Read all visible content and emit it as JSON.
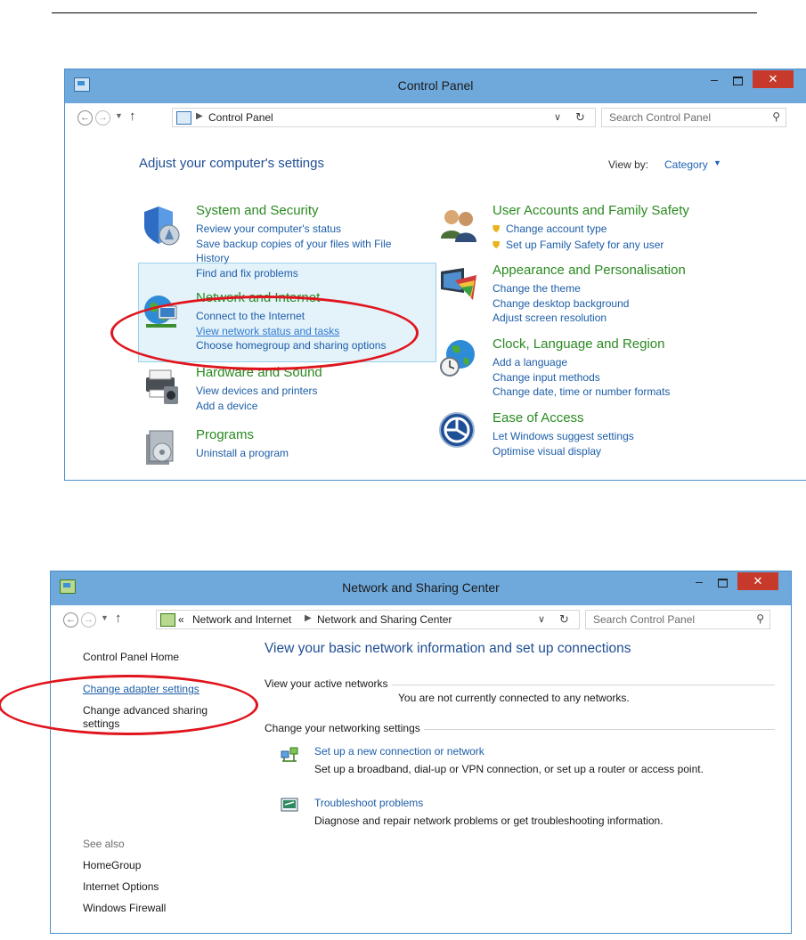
{
  "control_panel": {
    "title": "Control Panel",
    "address_crumb": "Control Panel",
    "search_placeholder": "Search Control Panel",
    "heading": "Adjust your computer's settings",
    "view_by_label": "View by:",
    "view_by_value": "Category",
    "categories": [
      {
        "title": "System and Security",
        "icon": "shield-icon",
        "links": [
          "Review your computer's status",
          "Save backup copies of your files with File",
          "History",
          "Find and fix problems"
        ]
      },
      {
        "title": "Network and Internet",
        "icon": "globe-network-icon",
        "links": [
          "Connect to the Internet",
          "View network status and tasks",
          "Choose homegroup and sharing options"
        ]
      },
      {
        "title": "Hardware and Sound",
        "icon": "printer-icon",
        "links": [
          "View devices and printers",
          "Add a device"
        ]
      },
      {
        "title": "Programs",
        "icon": "programs-icon",
        "links": [
          "Uninstall a program"
        ]
      },
      {
        "title": "User Accounts and Family Safety",
        "icon": "users-icon",
        "links": [
          "Change account type",
          "Set up Family Safety for any user"
        ]
      },
      {
        "title": "Appearance and Personalisation",
        "icon": "monitor-palette-icon",
        "links": [
          "Change the theme",
          "Change desktop background",
          "Adjust screen resolution"
        ]
      },
      {
        "title": "Clock, Language and Region",
        "icon": "globe-clock-icon",
        "links": [
          "Add a language",
          "Change input methods",
          "Change date, time or number formats"
        ]
      },
      {
        "title": "Ease of Access",
        "icon": "ease-of-access-icon",
        "links": [
          "Let Windows suggest settings",
          "Optimise visual display"
        ]
      }
    ]
  },
  "network_center": {
    "title": "Network and Sharing Center",
    "crumb_prefix": "«",
    "crumb_1": "Network and Internet",
    "crumb_2": "Network and Sharing Center",
    "search_placeholder": "Search Control Panel",
    "sidebar": {
      "home": "Control Panel Home",
      "adapter": "Change adapter settings",
      "advanced_1": "Change advanced sharing",
      "advanced_2": "settings",
      "see_also": "See also",
      "homegroup": "HomeGroup",
      "internet_options": "Internet Options",
      "firewall": "Windows Firewall"
    },
    "heading": "View your basic network information and set up connections",
    "active_networks_label": "View your active networks",
    "not_connected": "You are not currently connected to any networks.",
    "change_settings_label": "Change your networking settings",
    "task_1_link": "Set up a new connection or network",
    "task_1_desc": "Set up a broadband, dial-up or VPN connection, or set up a router or access point.",
    "task_2_link": "Troubleshoot problems",
    "task_2_desc": "Diagnose and repair network problems or get troubleshooting information."
  },
  "window_controls": {
    "minimize": "–",
    "close": "✕"
  },
  "colors": {
    "accent": "#6fa9dc",
    "link": "#1d5ea8",
    "category_green": "#2a8a21",
    "annotation_red": "#e0141c"
  }
}
